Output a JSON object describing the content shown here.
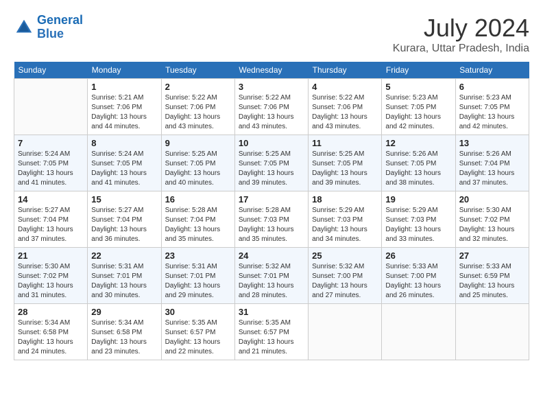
{
  "logo": {
    "line1": "General",
    "line2": "Blue"
  },
  "title": "July 2024",
  "location": "Kurara, Uttar Pradesh, India",
  "days_of_week": [
    "Sunday",
    "Monday",
    "Tuesday",
    "Wednesday",
    "Thursday",
    "Friday",
    "Saturday"
  ],
  "weeks": [
    [
      {
        "num": "",
        "info": ""
      },
      {
        "num": "1",
        "info": "Sunrise: 5:21 AM\nSunset: 7:06 PM\nDaylight: 13 hours\nand 44 minutes."
      },
      {
        "num": "2",
        "info": "Sunrise: 5:22 AM\nSunset: 7:06 PM\nDaylight: 13 hours\nand 43 minutes."
      },
      {
        "num": "3",
        "info": "Sunrise: 5:22 AM\nSunset: 7:06 PM\nDaylight: 13 hours\nand 43 minutes."
      },
      {
        "num": "4",
        "info": "Sunrise: 5:22 AM\nSunset: 7:06 PM\nDaylight: 13 hours\nand 43 minutes."
      },
      {
        "num": "5",
        "info": "Sunrise: 5:23 AM\nSunset: 7:05 PM\nDaylight: 13 hours\nand 42 minutes."
      },
      {
        "num": "6",
        "info": "Sunrise: 5:23 AM\nSunset: 7:05 PM\nDaylight: 13 hours\nand 42 minutes."
      }
    ],
    [
      {
        "num": "7",
        "info": "Sunrise: 5:24 AM\nSunset: 7:05 PM\nDaylight: 13 hours\nand 41 minutes."
      },
      {
        "num": "8",
        "info": "Sunrise: 5:24 AM\nSunset: 7:05 PM\nDaylight: 13 hours\nand 41 minutes."
      },
      {
        "num": "9",
        "info": "Sunrise: 5:25 AM\nSunset: 7:05 PM\nDaylight: 13 hours\nand 40 minutes."
      },
      {
        "num": "10",
        "info": "Sunrise: 5:25 AM\nSunset: 7:05 PM\nDaylight: 13 hours\nand 39 minutes."
      },
      {
        "num": "11",
        "info": "Sunrise: 5:25 AM\nSunset: 7:05 PM\nDaylight: 13 hours\nand 39 minutes."
      },
      {
        "num": "12",
        "info": "Sunrise: 5:26 AM\nSunset: 7:05 PM\nDaylight: 13 hours\nand 38 minutes."
      },
      {
        "num": "13",
        "info": "Sunrise: 5:26 AM\nSunset: 7:04 PM\nDaylight: 13 hours\nand 37 minutes."
      }
    ],
    [
      {
        "num": "14",
        "info": "Sunrise: 5:27 AM\nSunset: 7:04 PM\nDaylight: 13 hours\nand 37 minutes."
      },
      {
        "num": "15",
        "info": "Sunrise: 5:27 AM\nSunset: 7:04 PM\nDaylight: 13 hours\nand 36 minutes."
      },
      {
        "num": "16",
        "info": "Sunrise: 5:28 AM\nSunset: 7:04 PM\nDaylight: 13 hours\nand 35 minutes."
      },
      {
        "num": "17",
        "info": "Sunrise: 5:28 AM\nSunset: 7:03 PM\nDaylight: 13 hours\nand 35 minutes."
      },
      {
        "num": "18",
        "info": "Sunrise: 5:29 AM\nSunset: 7:03 PM\nDaylight: 13 hours\nand 34 minutes."
      },
      {
        "num": "19",
        "info": "Sunrise: 5:29 AM\nSunset: 7:03 PM\nDaylight: 13 hours\nand 33 minutes."
      },
      {
        "num": "20",
        "info": "Sunrise: 5:30 AM\nSunset: 7:02 PM\nDaylight: 13 hours\nand 32 minutes."
      }
    ],
    [
      {
        "num": "21",
        "info": "Sunrise: 5:30 AM\nSunset: 7:02 PM\nDaylight: 13 hours\nand 31 minutes."
      },
      {
        "num": "22",
        "info": "Sunrise: 5:31 AM\nSunset: 7:01 PM\nDaylight: 13 hours\nand 30 minutes."
      },
      {
        "num": "23",
        "info": "Sunrise: 5:31 AM\nSunset: 7:01 PM\nDaylight: 13 hours\nand 29 minutes."
      },
      {
        "num": "24",
        "info": "Sunrise: 5:32 AM\nSunset: 7:01 PM\nDaylight: 13 hours\nand 28 minutes."
      },
      {
        "num": "25",
        "info": "Sunrise: 5:32 AM\nSunset: 7:00 PM\nDaylight: 13 hours\nand 27 minutes."
      },
      {
        "num": "26",
        "info": "Sunrise: 5:33 AM\nSunset: 7:00 PM\nDaylight: 13 hours\nand 26 minutes."
      },
      {
        "num": "27",
        "info": "Sunrise: 5:33 AM\nSunset: 6:59 PM\nDaylight: 13 hours\nand 25 minutes."
      }
    ],
    [
      {
        "num": "28",
        "info": "Sunrise: 5:34 AM\nSunset: 6:58 PM\nDaylight: 13 hours\nand 24 minutes."
      },
      {
        "num": "29",
        "info": "Sunrise: 5:34 AM\nSunset: 6:58 PM\nDaylight: 13 hours\nand 23 minutes."
      },
      {
        "num": "30",
        "info": "Sunrise: 5:35 AM\nSunset: 6:57 PM\nDaylight: 13 hours\nand 22 minutes."
      },
      {
        "num": "31",
        "info": "Sunrise: 5:35 AM\nSunset: 6:57 PM\nDaylight: 13 hours\nand 21 minutes."
      },
      {
        "num": "",
        "info": ""
      },
      {
        "num": "",
        "info": ""
      },
      {
        "num": "",
        "info": ""
      }
    ]
  ]
}
